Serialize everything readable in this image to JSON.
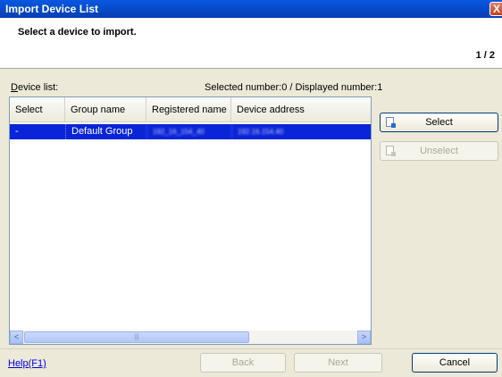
{
  "window": {
    "title": "Import Device List",
    "close_glyph": "X"
  },
  "header": {
    "instruction": "Select a device to import.",
    "step": "1 / 2"
  },
  "list": {
    "label_underlined": "D",
    "label_rest": "evice list:",
    "count_text": "Selected number:0 / Displayed number:1",
    "columns": [
      "Select",
      "Group name",
      "Registered name",
      "Device address"
    ],
    "rows": [
      {
        "select": "-",
        "group": "Default Group",
        "registered": "192_16_154_40",
        "address": "192.16.154.40"
      }
    ]
  },
  "buttons": {
    "select_label": "Select",
    "unselect_label": "Unselect",
    "back_label": "Back",
    "next_label": "Next",
    "cancel_label": "Cancel",
    "help_label": "Help(F1)"
  },
  "scrollbar": {
    "left_glyph": "<",
    "right_glyph": ">",
    "thumb_grip": "|||"
  },
  "icons": {
    "select_icon": "add-device-icon",
    "unselect_icon": "remove-device-icon",
    "close_icon": "close-icon"
  },
  "colors": {
    "title_bar": "#0549c8",
    "selection": "#0a24d8",
    "dialog_bg": "#ece9d8"
  }
}
